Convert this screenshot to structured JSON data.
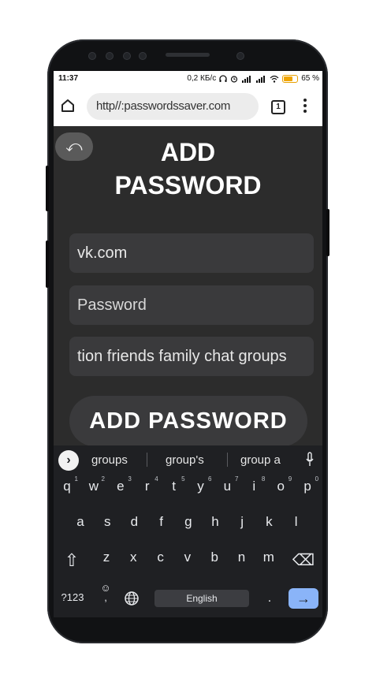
{
  "status": {
    "time": "11:37",
    "net_speed": "0,2 КБ/с",
    "battery": "65 %"
  },
  "browser": {
    "url": "http//:passwordssaver.com",
    "tab_count": "1"
  },
  "app": {
    "back_symbol": "⤺",
    "title_line1": "ADD",
    "title_line2": "PASSWORD",
    "site_value": "vk.com",
    "password_placeholder": "Password",
    "tags_value": "tion friends family chat groups",
    "submit_label": "ADD PASSWORD"
  },
  "keyboard": {
    "suggestions": [
      "groups",
      "group's",
      "group a"
    ],
    "row1": [
      {
        "k": "q",
        "h": "1"
      },
      {
        "k": "w",
        "h": "2"
      },
      {
        "k": "e",
        "h": "3"
      },
      {
        "k": "r",
        "h": "4"
      },
      {
        "k": "t",
        "h": "5"
      },
      {
        "k": "y",
        "h": "6"
      },
      {
        "k": "u",
        "h": "7"
      },
      {
        "k": "i",
        "h": "8"
      },
      {
        "k": "o",
        "h": "9"
      },
      {
        "k": "p",
        "h": "0"
      }
    ],
    "row2": [
      "a",
      "s",
      "d",
      "f",
      "g",
      "h",
      "j",
      "k",
      "l"
    ],
    "row3": [
      "z",
      "x",
      "c",
      "v",
      "b",
      "n",
      "m"
    ],
    "symbols_label": "?123",
    "emoji_symbol": "☺",
    "comma": ",",
    "space_label": "English",
    "period": ".",
    "enter_symbol": "→",
    "shift_symbol": "⇧",
    "backspace_symbol": "⌫",
    "suggest_arrow": "›",
    "globe_symbol": "🌐"
  },
  "colors": {
    "screen_bg": "#2c2c2c",
    "field_bg": "#3a3a3c",
    "keyboard_bg": "#1f2023",
    "enter_key": "#8ab4f8"
  }
}
